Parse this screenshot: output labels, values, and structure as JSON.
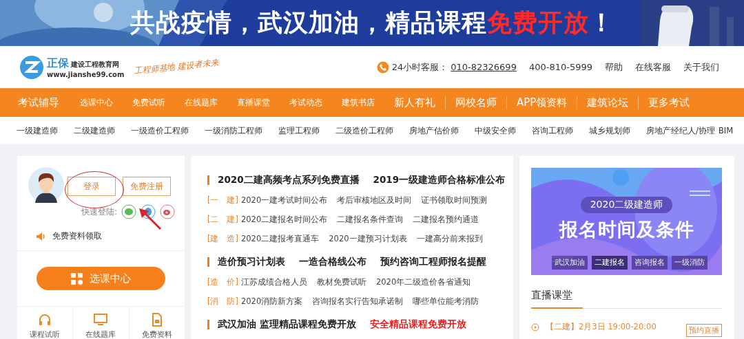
{
  "banner": {
    "kind": "picture",
    "text": "共战疫情，武汉加油，精品课程",
    "highlight": "免费开放",
    "end": "！"
  },
  "header": {
    "logo_brand": "正保",
    "logo_name": "建设工程教育网",
    "logo_url": "www.jianshe99.com",
    "slogan": "工程师基地 建设者未来",
    "hotline_label": "24小时客服：",
    "hotline": "010-82326699",
    "phone": "400-810-5999",
    "links": [
      "帮助",
      "在线客服",
      "关于我们"
    ]
  },
  "nav": [
    {
      "label": "考试辅导",
      "kind": "title"
    },
    {
      "label": "选课中心",
      "kind": "small"
    },
    {
      "label": "免费试听",
      "kind": "small"
    },
    {
      "label": "在线题库",
      "kind": "small"
    },
    {
      "label": "直播课堂",
      "kind": "small"
    },
    {
      "label": "考试动态",
      "kind": "small"
    },
    {
      "label": "建筑书店",
      "kind": "small"
    },
    {
      "label": "新人有礼",
      "kind": "large"
    },
    {
      "label": "网校名师",
      "kind": "large"
    },
    {
      "label": "APP领资料",
      "kind": "large"
    },
    {
      "label": "建筑论坛",
      "kind": "large"
    },
    {
      "label": "更多考试",
      "kind": "large"
    }
  ],
  "subnav": [
    "一级建造师",
    "二级建造师",
    "一级造价工程师",
    "一级消防工程师",
    "监理工程师",
    "二级造价工程师",
    "房地产估价师",
    "中级安全师",
    "咨询工程师",
    "城乡规划师",
    "房地产经纪人/协理",
    "BIM"
  ],
  "user_panel": {
    "login": "登录",
    "register": "免费注册",
    "quick_login": "快速登陆:",
    "free_material": "免费资料领取",
    "course_button": "选课中心",
    "shortcuts": [
      {
        "label": "课程试听",
        "kind": "headphones"
      },
      {
        "label": "在线题库",
        "kind": "monitor"
      },
      {
        "label": "免费资料",
        "kind": "document"
      }
    ]
  },
  "news": [
    {
      "headlines": [
        {
          "text": "2020二建高频考点系列免费直播",
          "hot": false
        },
        {
          "text": "2019一级建造师合格标准公布",
          "hot": false
        }
      ],
      "rows": [
        {
          "tag": "[一　建]",
          "links": [
            "2020一建考试时间公布",
            "考后审核地区及时间",
            "证书领取时间预测"
          ]
        },
        {
          "tag": "[二　建]",
          "links": [
            "2020二建报名时间公布",
            "二建报名条件查询",
            "二建报名预约通道"
          ]
        },
        {
          "tag": "[建　造]",
          "links": [
            "2020二建报考直通车",
            "2020一建预习计划表",
            "一建高分前来报到"
          ]
        }
      ]
    },
    {
      "headlines": [
        {
          "text": "造价预习计划表",
          "hot": false
        },
        {
          "text": "一造合格线公布",
          "hot": false
        },
        {
          "text": "预约咨询工程师报名提醒",
          "hot": false
        }
      ],
      "rows": [
        {
          "tag": "[造　价]",
          "links": [
            "江苏成绩合格人员",
            "教材免费试听",
            "2020年二级造价各省通知"
          ]
        },
        {
          "tag": "[消　防]",
          "links": [
            "2020消防新方案",
            "咨询报名实行告知承诺制",
            "哪些单位能考消防"
          ]
        }
      ]
    },
    {
      "headlines": [
        {
          "text": "武汉加油 监理精品课程免费开放",
          "hot": false
        },
        {
          "text": "安全精品课程免费开放",
          "hot": true
        }
      ]
    }
  ],
  "promo": {
    "kind": "picture",
    "subtitle": "2020二级建造师",
    "title": "报名时间及条件",
    "tabs": [
      {
        "label": "武汉加油",
        "selected": false
      },
      {
        "label": "二建报名",
        "selected": true
      },
      {
        "label": "咨询报名",
        "selected": false
      },
      {
        "label": "一级消防",
        "selected": false
      }
    ]
  },
  "live": {
    "title": "直播课堂",
    "items": [
      {
        "time": "【二建】2月3日 19:00-20:00",
        "action": "预约直播"
      }
    ]
  }
}
